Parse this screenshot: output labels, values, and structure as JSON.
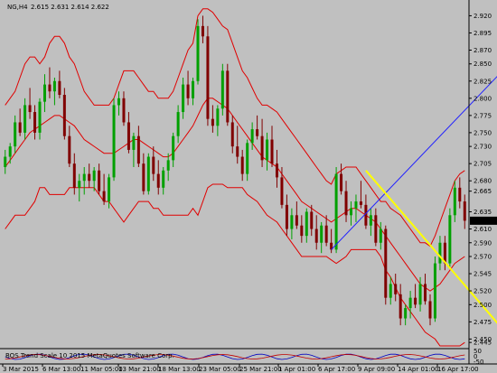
{
  "header": {
    "symbol_timeframe": "NG,H4",
    "ohlc": "2.615 2.631 2.614 2.622"
  },
  "price_axis": {
    "ticks": [
      "2.920",
      "2.895",
      "2.870",
      "2.850",
      "2.825",
      "2.800",
      "2.775",
      "2.750",
      "2.730",
      "2.705",
      "2.680",
      "2.665",
      "2.635",
      "2.610",
      "2.590",
      "2.570",
      "2.545",
      "2.520",
      "2.500",
      "2.475",
      "2.450",
      "2.445"
    ],
    "current_price": "2.622",
    "indicator_ticks": [
      "50",
      "0",
      "-50"
    ]
  },
  "time_axis": {
    "labels": [
      "3 Mar 2015",
      "6 Mar 13:00",
      "11 Mar 05:00",
      "13 Mar 21:00",
      "18 Mar 13:00",
      "23 Mar 05:00",
      "25 Mar 21:00",
      "1 Apr 01:00",
      "6 Apr 17:00",
      "9 Apr 09:00",
      "14 Apr 01:00",
      "16 Apr 17:00"
    ]
  },
  "indicator": {
    "caption": "BOS Trend Scale 10 2015 MetaQuotes Software Corp."
  },
  "colors": {
    "background": "#c0c0c0",
    "bollinger": "#e00000",
    "bull_candle": "#00a000",
    "bear_candle": "#800000",
    "trendline_blue": "#2020ff",
    "trendline_yellow": "#ffff00"
  },
  "chart_data": {
    "type": "candlestick",
    "symbol": "NG",
    "timeframe": "H4",
    "ylim": [
      2.44,
      2.935
    ],
    "candles": [
      [
        2.7,
        2.725,
        2.69,
        2.715
      ],
      [
        2.715,
        2.735,
        2.705,
        2.73
      ],
      [
        2.73,
        2.775,
        2.72,
        2.765
      ],
      [
        2.765,
        2.785,
        2.745,
        2.75
      ],
      [
        2.75,
        2.8,
        2.74,
        2.79
      ],
      [
        2.79,
        2.815,
        2.77,
        2.78
      ],
      [
        2.78,
        2.79,
        2.74,
        2.75
      ],
      [
        2.75,
        2.8,
        2.74,
        2.795
      ],
      [
        2.795,
        2.835,
        2.78,
        2.82
      ],
      [
        2.82,
        2.845,
        2.8,
        2.81
      ],
      [
        2.81,
        2.83,
        2.79,
        2.825
      ],
      [
        2.825,
        2.84,
        2.8,
        2.805
      ],
      [
        2.805,
        2.815,
        2.74,
        2.745
      ],
      [
        2.745,
        2.76,
        2.7,
        2.705
      ],
      [
        2.705,
        2.72,
        2.66,
        2.67
      ],
      [
        2.67,
        2.69,
        2.65,
        2.68
      ],
      [
        2.68,
        2.7,
        2.66,
        2.69
      ],
      [
        2.69,
        2.705,
        2.67,
        2.68
      ],
      [
        2.68,
        2.7,
        2.665,
        2.695
      ],
      [
        2.695,
        2.705,
        2.66,
        2.665
      ],
      [
        2.665,
        2.69,
        2.645,
        2.65
      ],
      [
        2.65,
        2.69,
        2.64,
        2.685
      ],
      [
        2.685,
        2.8,
        2.68,
        2.79
      ],
      [
        2.79,
        2.81,
        2.775,
        2.8
      ],
      [
        2.8,
        2.81,
        2.76,
        2.765
      ],
      [
        2.765,
        2.78,
        2.72,
        2.725
      ],
      [
        2.725,
        2.75,
        2.7,
        2.745
      ],
      [
        2.745,
        2.76,
        2.7,
        2.705
      ],
      [
        2.705,
        2.72,
        2.66,
        2.665
      ],
      [
        2.665,
        2.72,
        2.66,
        2.715
      ],
      [
        2.715,
        2.73,
        2.68,
        2.69
      ],
      [
        2.69,
        2.71,
        2.66,
        2.67
      ],
      [
        2.67,
        2.7,
        2.66,
        2.695
      ],
      [
        2.695,
        2.72,
        2.68,
        2.71
      ],
      [
        2.71,
        2.75,
        2.7,
        2.745
      ],
      [
        2.745,
        2.79,
        2.735,
        2.78
      ],
      [
        2.78,
        2.83,
        2.77,
        2.82
      ],
      [
        2.82,
        2.84,
        2.79,
        2.8
      ],
      [
        2.8,
        2.83,
        2.79,
        2.825
      ],
      [
        2.825,
        2.915,
        2.82,
        2.905
      ],
      [
        2.905,
        2.92,
        2.88,
        2.89
      ],
      [
        2.89,
        2.905,
        2.76,
        2.77
      ],
      [
        2.77,
        2.79,
        2.75,
        2.76
      ],
      [
        2.76,
        2.79,
        2.745,
        2.785
      ],
      [
        2.785,
        2.85,
        2.775,
        2.84
      ],
      [
        2.84,
        2.85,
        2.76,
        2.765
      ],
      [
        2.765,
        2.775,
        2.72,
        2.73
      ],
      [
        2.73,
        2.76,
        2.705,
        2.715
      ],
      [
        2.715,
        2.725,
        2.68,
        2.69
      ],
      [
        2.69,
        2.74,
        2.68,
        2.735
      ],
      [
        2.735,
        2.765,
        2.725,
        2.755
      ],
      [
        2.755,
        2.775,
        2.74,
        2.745
      ],
      [
        2.745,
        2.77,
        2.7,
        2.71
      ],
      [
        2.71,
        2.75,
        2.695,
        2.74
      ],
      [
        2.74,
        2.76,
        2.7,
        2.705
      ],
      [
        2.705,
        2.725,
        2.67,
        2.685
      ],
      [
        2.685,
        2.7,
        2.64,
        2.645
      ],
      [
        2.645,
        2.66,
        2.6,
        2.61
      ],
      [
        2.61,
        2.64,
        2.595,
        2.63
      ],
      [
        2.63,
        2.65,
        2.61,
        2.615
      ],
      [
        2.615,
        2.63,
        2.59,
        2.6
      ],
      [
        2.6,
        2.64,
        2.59,
        2.635
      ],
      [
        2.635,
        2.645,
        2.6,
        2.61
      ],
      [
        2.61,
        2.63,
        2.58,
        2.59
      ],
      [
        2.59,
        2.62,
        2.575,
        2.615
      ],
      [
        2.615,
        2.63,
        2.585,
        2.59
      ],
      [
        2.59,
        2.61,
        2.575,
        2.58
      ],
      [
        2.58,
        2.7,
        2.575,
        2.69
      ],
      [
        2.69,
        2.705,
        2.66,
        2.665
      ],
      [
        2.665,
        2.68,
        2.62,
        2.63
      ],
      [
        2.63,
        2.65,
        2.615,
        2.64
      ],
      [
        2.64,
        2.66,
        2.62,
        2.65
      ],
      [
        2.65,
        2.68,
        2.64,
        2.645
      ],
      [
        2.645,
        2.66,
        2.61,
        2.615
      ],
      [
        2.615,
        2.64,
        2.6,
        2.63
      ],
      [
        2.63,
        2.64,
        2.585,
        2.59
      ],
      [
        2.59,
        2.62,
        2.58,
        2.61
      ],
      [
        2.61,
        2.615,
        2.5,
        2.51
      ],
      [
        2.51,
        2.54,
        2.5,
        2.53
      ],
      [
        2.53,
        2.545,
        2.505,
        2.515
      ],
      [
        2.515,
        2.53,
        2.47,
        2.48
      ],
      [
        2.48,
        2.5,
        2.47,
        2.495
      ],
      [
        2.495,
        2.52,
        2.48,
        2.51
      ],
      [
        2.51,
        2.53,
        2.495,
        2.5
      ],
      [
        2.5,
        2.54,
        2.49,
        2.53
      ],
      [
        2.53,
        2.545,
        2.5,
        2.505
      ],
      [
        2.505,
        2.515,
        2.47,
        2.48
      ],
      [
        2.48,
        2.57,
        2.475,
        2.56
      ],
      [
        2.56,
        2.6,
        2.55,
        2.59
      ],
      [
        2.59,
        2.6,
        2.55,
        2.56
      ],
      [
        2.56,
        2.64,
        2.555,
        2.63
      ],
      [
        2.63,
        2.68,
        2.62,
        2.67
      ],
      [
        2.67,
        2.685,
        2.64,
        2.65
      ],
      [
        2.65,
        2.66,
        2.61,
        2.622
      ]
    ],
    "series": [
      {
        "values": [
          2.79,
          2.8,
          2.81,
          2.83,
          2.85,
          2.86,
          2.86,
          2.85,
          2.86,
          2.88,
          2.89,
          2.89,
          2.88,
          2.86,
          2.85,
          2.83,
          2.81,
          2.8,
          2.79,
          2.79,
          2.79,
          2.79,
          2.8,
          2.82,
          2.84,
          2.84,
          2.84,
          2.83,
          2.82,
          2.81,
          2.81,
          2.8,
          2.8,
          2.8,
          2.81,
          2.83,
          2.85,
          2.87,
          2.88,
          2.92,
          2.93,
          2.93,
          2.925,
          2.915,
          2.905,
          2.9,
          2.88,
          2.86,
          2.84,
          2.83,
          2.815,
          2.8,
          2.79,
          2.79,
          2.785,
          2.78,
          2.77,
          2.76,
          2.75,
          2.74,
          2.73,
          2.72,
          2.71,
          2.7,
          2.69,
          2.68,
          2.675,
          2.69,
          2.695,
          2.7,
          2.7,
          2.7,
          2.69,
          2.68,
          2.67,
          2.66,
          2.65,
          2.65,
          2.64,
          2.635,
          2.63,
          2.62,
          2.61,
          2.6,
          2.59,
          2.59,
          2.585,
          2.6,
          2.62,
          2.64,
          2.66,
          2.68,
          2.69,
          2.695
        ]
      },
      {
        "values": [
          2.7,
          2.71,
          2.72,
          2.73,
          2.74,
          2.75,
          2.755,
          2.76,
          2.765,
          2.77,
          2.775,
          2.775,
          2.77,
          2.765,
          2.76,
          2.75,
          2.74,
          2.735,
          2.73,
          2.725,
          2.72,
          2.72,
          2.72,
          2.725,
          2.73,
          2.735,
          2.74,
          2.74,
          2.735,
          2.73,
          2.725,
          2.72,
          2.715,
          2.715,
          2.72,
          2.73,
          2.74,
          2.75,
          2.76,
          2.775,
          2.79,
          2.8,
          2.8,
          2.795,
          2.79,
          2.785,
          2.775,
          2.765,
          2.755,
          2.745,
          2.735,
          2.725,
          2.715,
          2.71,
          2.705,
          2.7,
          2.69,
          2.68,
          2.67,
          2.66,
          2.65,
          2.645,
          2.64,
          2.635,
          2.63,
          2.625,
          2.62,
          2.625,
          2.63,
          2.635,
          2.64,
          2.64,
          2.635,
          2.63,
          2.625,
          2.62,
          2.61,
          2.6,
          2.59,
          2.58,
          2.57,
          2.56,
          2.55,
          2.54,
          2.53,
          2.525,
          2.52,
          2.525,
          2.53,
          2.54,
          2.55,
          2.56,
          2.565,
          2.57
        ]
      },
      {
        "values": [
          2.61,
          2.62,
          2.63,
          2.63,
          2.63,
          2.64,
          2.65,
          2.67,
          2.67,
          2.66,
          2.66,
          2.66,
          2.66,
          2.67,
          2.67,
          2.67,
          2.67,
          2.67,
          2.67,
          2.66,
          2.65,
          2.65,
          2.64,
          2.63,
          2.62,
          2.63,
          2.64,
          2.65,
          2.65,
          2.65,
          2.64,
          2.64,
          2.63,
          2.63,
          2.63,
          2.63,
          2.63,
          2.63,
          2.64,
          2.63,
          2.65,
          2.67,
          2.675,
          2.675,
          2.675,
          2.67,
          2.67,
          2.67,
          2.67,
          2.66,
          2.655,
          2.65,
          2.64,
          2.63,
          2.625,
          2.62,
          2.61,
          2.6,
          2.59,
          2.58,
          2.57,
          2.57,
          2.57,
          2.57,
          2.57,
          2.57,
          2.565,
          2.56,
          2.565,
          2.57,
          2.58,
          2.58,
          2.58,
          2.58,
          2.58,
          2.58,
          2.57,
          2.55,
          2.54,
          2.525,
          2.51,
          2.5,
          2.49,
          2.48,
          2.47,
          2.46,
          2.455,
          2.45,
          2.44,
          2.44,
          2.44,
          2.44,
          2.44,
          2.445
        ]
      }
    ],
    "trendlines": [
      {
        "from": [
          66,
          2.58
        ],
        "to": [
          106,
          2.88
        ]
      },
      {
        "from": [
          73,
          2.695
        ],
        "to": [
          103,
          2.445
        ]
      }
    ]
  }
}
